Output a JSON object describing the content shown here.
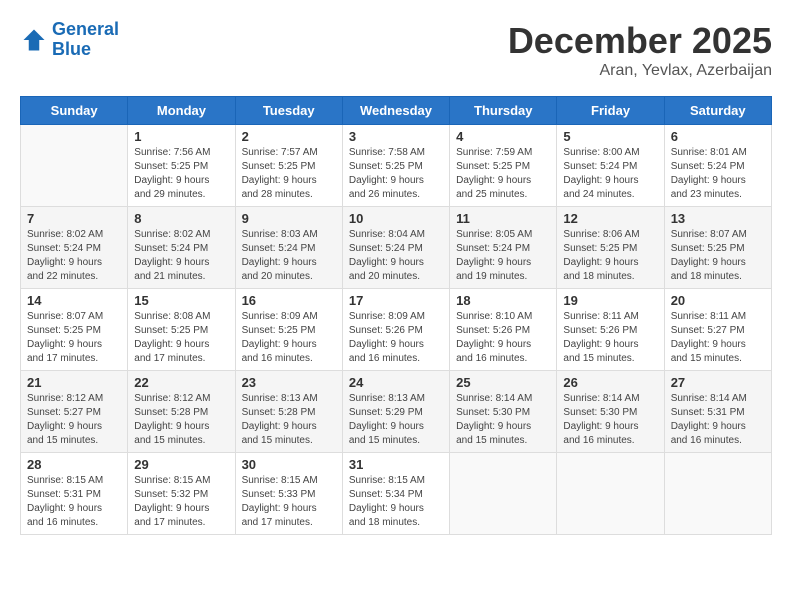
{
  "header": {
    "logo_general": "General",
    "logo_blue": "Blue",
    "month": "December 2025",
    "location": "Aran, Yevlax, Azerbaijan"
  },
  "weekdays": [
    "Sunday",
    "Monday",
    "Tuesday",
    "Wednesday",
    "Thursday",
    "Friday",
    "Saturday"
  ],
  "rows": [
    [
      {
        "num": "",
        "info": ""
      },
      {
        "num": "1",
        "info": "Sunrise: 7:56 AM\nSunset: 5:25 PM\nDaylight: 9 hours\nand 29 minutes."
      },
      {
        "num": "2",
        "info": "Sunrise: 7:57 AM\nSunset: 5:25 PM\nDaylight: 9 hours\nand 28 minutes."
      },
      {
        "num": "3",
        "info": "Sunrise: 7:58 AM\nSunset: 5:25 PM\nDaylight: 9 hours\nand 26 minutes."
      },
      {
        "num": "4",
        "info": "Sunrise: 7:59 AM\nSunset: 5:25 PM\nDaylight: 9 hours\nand 25 minutes."
      },
      {
        "num": "5",
        "info": "Sunrise: 8:00 AM\nSunset: 5:24 PM\nDaylight: 9 hours\nand 24 minutes."
      },
      {
        "num": "6",
        "info": "Sunrise: 8:01 AM\nSunset: 5:24 PM\nDaylight: 9 hours\nand 23 minutes."
      }
    ],
    [
      {
        "num": "7",
        "info": "Sunrise: 8:02 AM\nSunset: 5:24 PM\nDaylight: 9 hours\nand 22 minutes."
      },
      {
        "num": "8",
        "info": "Sunrise: 8:02 AM\nSunset: 5:24 PM\nDaylight: 9 hours\nand 21 minutes."
      },
      {
        "num": "9",
        "info": "Sunrise: 8:03 AM\nSunset: 5:24 PM\nDaylight: 9 hours\nand 20 minutes."
      },
      {
        "num": "10",
        "info": "Sunrise: 8:04 AM\nSunset: 5:24 PM\nDaylight: 9 hours\nand 20 minutes."
      },
      {
        "num": "11",
        "info": "Sunrise: 8:05 AM\nSunset: 5:24 PM\nDaylight: 9 hours\nand 19 minutes."
      },
      {
        "num": "12",
        "info": "Sunrise: 8:06 AM\nSunset: 5:25 PM\nDaylight: 9 hours\nand 18 minutes."
      },
      {
        "num": "13",
        "info": "Sunrise: 8:07 AM\nSunset: 5:25 PM\nDaylight: 9 hours\nand 18 minutes."
      }
    ],
    [
      {
        "num": "14",
        "info": "Sunrise: 8:07 AM\nSunset: 5:25 PM\nDaylight: 9 hours\nand 17 minutes."
      },
      {
        "num": "15",
        "info": "Sunrise: 8:08 AM\nSunset: 5:25 PM\nDaylight: 9 hours\nand 17 minutes."
      },
      {
        "num": "16",
        "info": "Sunrise: 8:09 AM\nSunset: 5:25 PM\nDaylight: 9 hours\nand 16 minutes."
      },
      {
        "num": "17",
        "info": "Sunrise: 8:09 AM\nSunset: 5:26 PM\nDaylight: 9 hours\nand 16 minutes."
      },
      {
        "num": "18",
        "info": "Sunrise: 8:10 AM\nSunset: 5:26 PM\nDaylight: 9 hours\nand 16 minutes."
      },
      {
        "num": "19",
        "info": "Sunrise: 8:11 AM\nSunset: 5:26 PM\nDaylight: 9 hours\nand 15 minutes."
      },
      {
        "num": "20",
        "info": "Sunrise: 8:11 AM\nSunset: 5:27 PM\nDaylight: 9 hours\nand 15 minutes."
      }
    ],
    [
      {
        "num": "21",
        "info": "Sunrise: 8:12 AM\nSunset: 5:27 PM\nDaylight: 9 hours\nand 15 minutes."
      },
      {
        "num": "22",
        "info": "Sunrise: 8:12 AM\nSunset: 5:28 PM\nDaylight: 9 hours\nand 15 minutes."
      },
      {
        "num": "23",
        "info": "Sunrise: 8:13 AM\nSunset: 5:28 PM\nDaylight: 9 hours\nand 15 minutes."
      },
      {
        "num": "24",
        "info": "Sunrise: 8:13 AM\nSunset: 5:29 PM\nDaylight: 9 hours\nand 15 minutes."
      },
      {
        "num": "25",
        "info": "Sunrise: 8:14 AM\nSunset: 5:30 PM\nDaylight: 9 hours\nand 15 minutes."
      },
      {
        "num": "26",
        "info": "Sunrise: 8:14 AM\nSunset: 5:30 PM\nDaylight: 9 hours\nand 16 minutes."
      },
      {
        "num": "27",
        "info": "Sunrise: 8:14 AM\nSunset: 5:31 PM\nDaylight: 9 hours\nand 16 minutes."
      }
    ],
    [
      {
        "num": "28",
        "info": "Sunrise: 8:15 AM\nSunset: 5:31 PM\nDaylight: 9 hours\nand 16 minutes."
      },
      {
        "num": "29",
        "info": "Sunrise: 8:15 AM\nSunset: 5:32 PM\nDaylight: 9 hours\nand 17 minutes."
      },
      {
        "num": "30",
        "info": "Sunrise: 8:15 AM\nSunset: 5:33 PM\nDaylight: 9 hours\nand 17 minutes."
      },
      {
        "num": "31",
        "info": "Sunrise: 8:15 AM\nSunset: 5:34 PM\nDaylight: 9 hours\nand 18 minutes."
      },
      {
        "num": "",
        "info": ""
      },
      {
        "num": "",
        "info": ""
      },
      {
        "num": "",
        "info": ""
      }
    ]
  ]
}
